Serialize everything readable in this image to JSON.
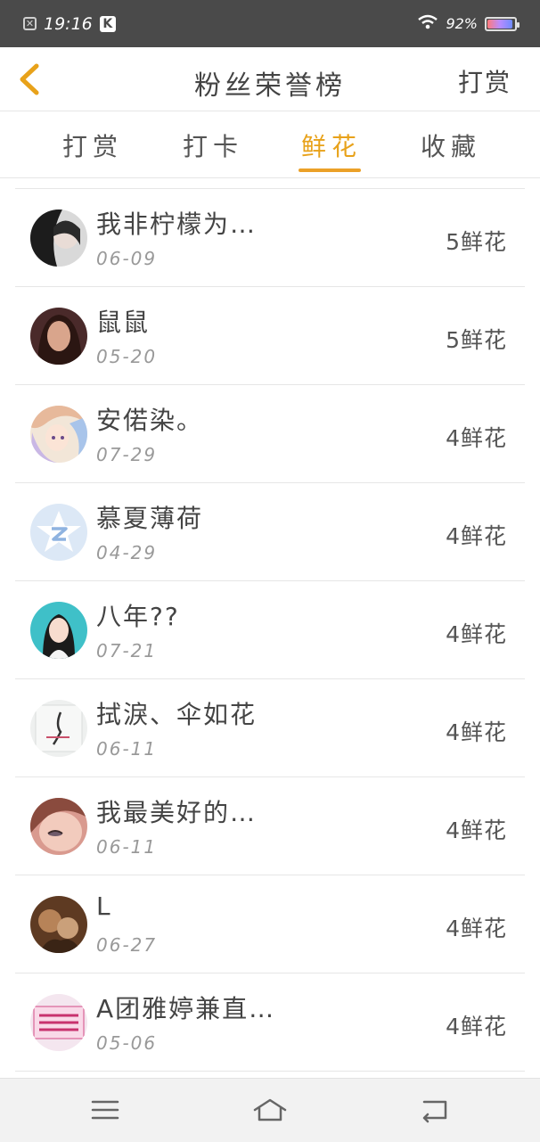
{
  "status": {
    "time": "19:16",
    "battery": "92%",
    "battery_fraction": 0.92
  },
  "nav": {
    "title": "粉丝荣誉榜",
    "right_action": "打赏"
  },
  "tabs": [
    {
      "label": "打赏",
      "active": false
    },
    {
      "label": "打卡",
      "active": false
    },
    {
      "label": "鲜花",
      "active": true
    },
    {
      "label": "收藏",
      "active": false
    }
  ],
  "list": [
    {
      "name": "我非柠檬为…",
      "date": "06-09",
      "count": "5鲜花"
    },
    {
      "name": "鼠鼠",
      "date": "05-20",
      "count": "5鲜花"
    },
    {
      "name": "安偌染。",
      "date": "07-29",
      "count": "4鲜花"
    },
    {
      "name": "慕夏薄荷",
      "date": "04-29",
      "count": "4鲜花"
    },
    {
      "name": "八年??",
      "date": "07-21",
      "count": "4鲜花"
    },
    {
      "name": "拭淚、伞如花",
      "date": "06-11",
      "count": "4鲜花"
    },
    {
      "name": "我最美好的…",
      "date": "06-11",
      "count": "4鲜花"
    },
    {
      "name": "L",
      "date": "06-27",
      "count": "4鲜花"
    },
    {
      "name": "A团雅婷兼直…",
      "date": "05-06",
      "count": "4鲜花"
    }
  ],
  "colors": {
    "accent": "#e8a21a",
    "status_bar": "#4a4a4a",
    "bottom_bar": "#f2f2f2"
  }
}
